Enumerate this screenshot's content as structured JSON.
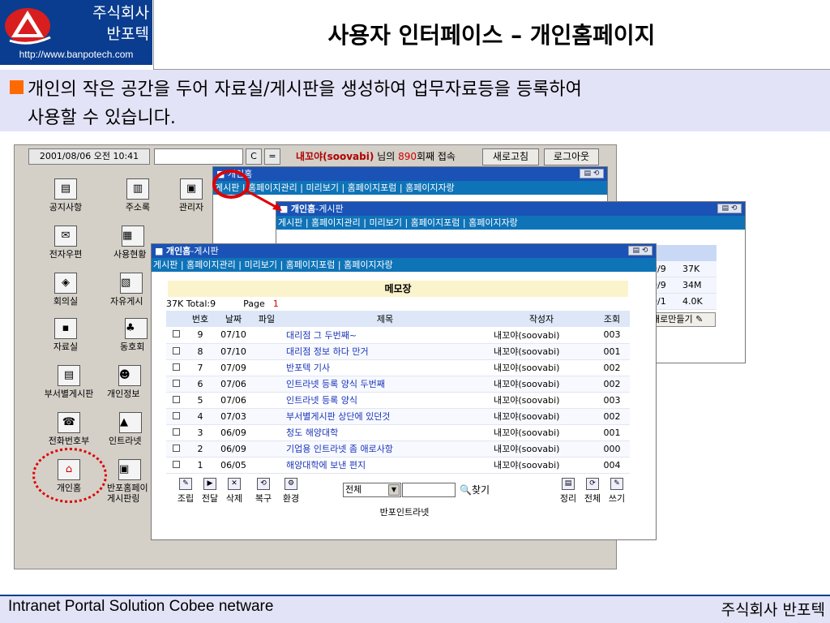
{
  "header": {
    "company_line1": "주식회사",
    "company_line2": "반포텍",
    "url": "http://www.banpotech.com",
    "title": "사용자 인터페이스 – 개인홈페이지"
  },
  "description": {
    "line1": "개인의 작은 공간을 두어 자료실/게시판을 생성하여 업무자료등을 등록하여",
    "line2": "사용할 수 있습니다."
  },
  "topbar": {
    "datetime": "2001/08/06 오전 10:41",
    "btn_c": "C",
    "btn_eq": "=",
    "user_name": "내꼬야(soovabi)",
    "user_mid": " 님의 ",
    "visit_count": "890",
    "user_tail": "회째 접속",
    "refresh": "새로고침",
    "logout": "로그아웃"
  },
  "desktop_icons": [
    {
      "label": "공지사항",
      "glyph": "▤"
    },
    {
      "label": "주소록",
      "glyph": "▥"
    },
    {
      "label": "관리자",
      "glyph": "▣"
    },
    {
      "label": "전자우편",
      "glyph": "✉"
    },
    {
      "label": "사용현황",
      "glyph": "▦"
    },
    {
      "label": "회의실",
      "glyph": "◈"
    },
    {
      "label": "자유게시",
      "glyph": "▧"
    },
    {
      "label": "자료실",
      "glyph": "▪"
    },
    {
      "label": "동호회",
      "glyph": "♣"
    },
    {
      "label": "부서별게시판",
      "glyph": "▤"
    },
    {
      "label": "개인정보",
      "glyph": "☻"
    },
    {
      "label": "전화번호부",
      "glyph": "☎"
    },
    {
      "label": "인트라넷",
      "glyph": "▲"
    },
    {
      "label": "개인홈",
      "glyph": "⌂"
    },
    {
      "label": "반포홈페이",
      "glyph": "▣"
    },
    {
      "label": "게시판링",
      "glyph": ""
    }
  ],
  "win_back": {
    "title": "개인홈",
    "menu": "게시판 | 홈페이지관리 | 미리보기 | 홈페이지포럼 | 홈페이지자랑"
  },
  "win_mid": {
    "title": "개인홈",
    "title_suffix": "-게시판",
    "menu": "게시판 | 홈페이지관리 | 미리보기 | 홈페이지포럼 | 홈페이지자랑",
    "rows": [
      {
        "date": "0/9",
        "size": "37K"
      },
      {
        "date": "0/9",
        "size": "34M"
      },
      {
        "date": "0/1",
        "size": "4.0K"
      }
    ],
    "make_button": "새로만들기"
  },
  "win_front": {
    "title": "개인홈",
    "title_suffix": "-게시판",
    "menu": "게시판 | 홈페이지관리 | 미리보기 | 홈페이지포럼 | 홈페이지자랑",
    "memo_title": "메모장",
    "stats": "37K Total:9",
    "page_label": "Page",
    "page_num": "1",
    "columns": [
      "번호",
      "날짜",
      "파일",
      "제목",
      "작성자",
      "조회"
    ],
    "rows": [
      {
        "no": "9",
        "date": "07/10",
        "subject": "대리점 그 두번째~",
        "author": "내꼬야(soovabi)",
        "views": "003"
      },
      {
        "no": "8",
        "date": "07/10",
        "subject": "대리점 정보 하다 만거",
        "author": "내꼬야(soovabi)",
        "views": "001"
      },
      {
        "no": "7",
        "date": "07/09",
        "subject": "반포텍 기사",
        "author": "내꼬야(soovabi)",
        "views": "002"
      },
      {
        "no": "6",
        "date": "07/06",
        "subject": "인트라넷 등록 양식 두번째",
        "author": "내꼬야(soovabi)",
        "views": "002"
      },
      {
        "no": "5",
        "date": "07/06",
        "subject": "인트라넷 등록 양식",
        "author": "내꼬야(soovabi)",
        "views": "003"
      },
      {
        "no": "4",
        "date": "07/03",
        "subject": "부서별게시판 상단에 있던것",
        "author": "내꼬야(soovabi)",
        "views": "002"
      },
      {
        "no": "3",
        "date": "06/09",
        "subject": "청도 해양대학",
        "author": "내꼬야(soovabi)",
        "views": "001"
      },
      {
        "no": "2",
        "date": "06/09",
        "subject": "기업용 인트라넷 좀 애로사항",
        "author": "내꼬야(soovabi)",
        "views": "000"
      },
      {
        "no": "1",
        "date": "06/05",
        "subject": "해양대학에 보낸 편지",
        "author": "내꼬야(soovabi)",
        "views": "004"
      }
    ],
    "tools_left": [
      "조립",
      "전달",
      "삭제",
      "복구",
      "환경"
    ],
    "select_value": "전체",
    "search_label": "찾기",
    "tools_right": [
      "정리",
      "전체",
      "쓰기"
    ],
    "footer": "반포인트라넷"
  },
  "bottom": {
    "left": "Intranet Portal Solution Cobee netware",
    "right": "주식회사 반포텍"
  },
  "colors": {
    "brand_blue": "#0a3d8f",
    "band": "#e3e3f7",
    "bullet_orange": "#ff6a00",
    "highlight_red": "#e00000"
  }
}
